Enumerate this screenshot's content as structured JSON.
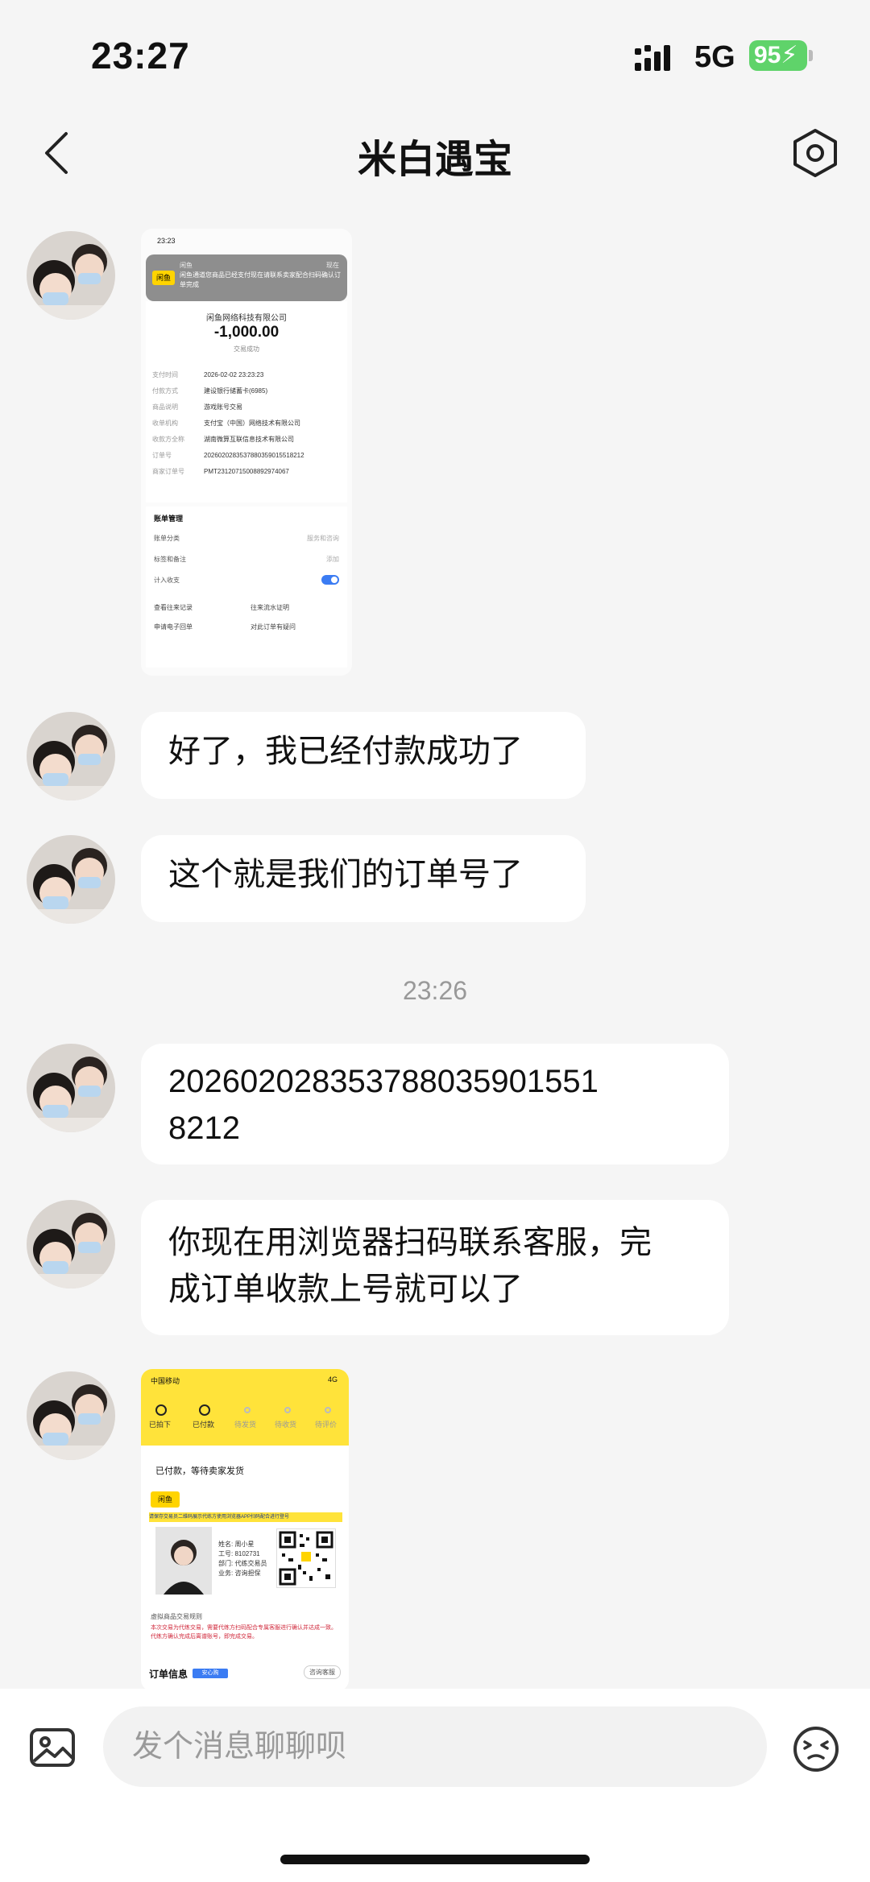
{
  "status_bar": {
    "time": "23:27",
    "network": "5G",
    "battery": "95"
  },
  "header": {
    "title": "米白遇宝"
  },
  "messages": [
    {
      "type": "image",
      "name": "payment-receipt-screenshot"
    },
    {
      "type": "text",
      "text": "好了，我已经付款成功了"
    },
    {
      "type": "text",
      "text": "这个就是我们的订单号了"
    },
    {
      "type": "text",
      "text": "20260202835378803590155 18212"
    },
    {
      "type": "text",
      "text": "你现在用浏览器扫码联系客服，完成订单收款上号就可以了"
    },
    {
      "type": "image",
      "name": "order-status-screenshot"
    }
  ],
  "timestamp": "23:26",
  "order_number_line1": "202602028353788035901551",
  "order_number_line2": "8212",
  "msg5_line1": "你现在用浏览器扫码联系客服，完",
  "msg5_line2": "成订单收款上号就可以了",
  "receipt": {
    "top_time": "23:23",
    "notif_app": "闲鱼",
    "notif_time": "现在",
    "notif_logo": "闲鱼",
    "notif_body": "闲鱼通道您商品已经支付现在请联系卖家配合扫码确认订单完成",
    "company": "闲鱼网络科技有限公司",
    "amount": "-1,000.00",
    "status": "交易成功",
    "rows": [
      {
        "k": "支付时间",
        "v": "2026-02-02 23:23:23"
      },
      {
        "k": "付款方式",
        "v": "建设银行储蓄卡(6985)"
      },
      {
        "k": "商品说明",
        "v": "游戏账号交易"
      },
      {
        "k": "收单机构",
        "v": "支付宝（中国）网络技术有限公司"
      },
      {
        "k": "收款方全称",
        "v": "湖南微算互联信息技术有限公司"
      },
      {
        "k": "订单号",
        "v": "2026020283537880359015518212"
      },
      {
        "k": "商家订单号",
        "v": "PMT23120715008892974067"
      }
    ],
    "bill_mgmt": "账单管理",
    "bill_category": "账单分类",
    "bill_category_value": "服务和咨询",
    "tags": "标签和备注",
    "tags_value": "添加",
    "count_income": "计入收支",
    "link1": "查看往来记录",
    "link2": "往来流水证明",
    "link3": "申请电子回单",
    "link4": "对此订单有疑问"
  },
  "order_shot": {
    "carrier": "中国移动",
    "net": "4G",
    "steps": [
      "已拍下",
      "已付款",
      "待发货",
      "待收货",
      "待评价"
    ],
    "paid_status": "已付款，等待卖家发货",
    "logo": "闲鱼",
    "notice": "请保存交易员二维码展示代练方使用浏览器APP扫码配合进行登号",
    "info": [
      "姓名: 周小星",
      "工号: 8102731",
      "部门: 代练交易员",
      "业务: 咨询担保"
    ],
    "rules_title": "虚拟商品交易规则",
    "rules_text": "本次交易为代练交易，需要代练方扫码配合专属客服进行确认并达成一致。代练方确认完成后离谱账号，即完成交易。",
    "order_info": "订单信息",
    "order_tag": "安心购",
    "order_btn": "咨询客服"
  },
  "input": {
    "placeholder": "发个消息聊聊呗"
  }
}
